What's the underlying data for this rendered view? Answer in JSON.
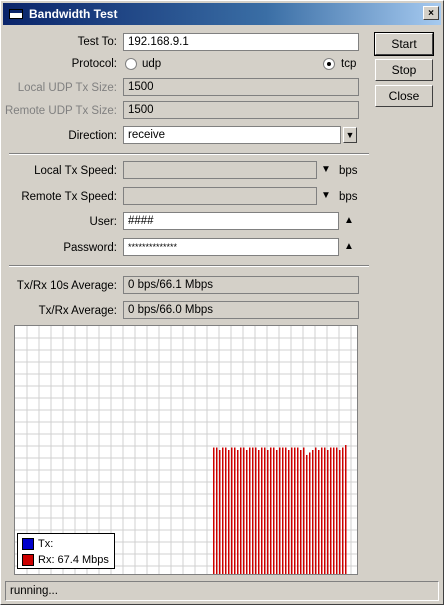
{
  "window": {
    "title": "Bandwidth Test",
    "close_glyph": "×"
  },
  "form": {
    "test_to": {
      "label": "Test To:",
      "value": "192.168.9.1"
    },
    "protocol": {
      "label": "Protocol:",
      "options": [
        "udp",
        "tcp"
      ],
      "selected": "tcp"
    },
    "local_udp_tx_size": {
      "label": "Local UDP Tx Size:",
      "value": "1500"
    },
    "remote_udp_tx_size": {
      "label": "Remote UDP Tx Size:",
      "value": "1500"
    },
    "direction": {
      "label": "Direction:",
      "value": "receive"
    },
    "local_tx_speed": {
      "label": "Local Tx Speed:",
      "value": "",
      "unit": "bps"
    },
    "remote_tx_speed": {
      "label": "Remote Tx Speed:",
      "value": "",
      "unit": "bps"
    },
    "user": {
      "label": "User:",
      "value": "####"
    },
    "password": {
      "label": "Password:",
      "value": "**************"
    },
    "avg_10s": {
      "label": "Tx/Rx 10s Average:",
      "value": "0 bps/66.1 Mbps"
    },
    "avg": {
      "label": "Tx/Rx Average:",
      "value": "0 bps/66.0 Mbps"
    }
  },
  "buttons": {
    "start": "Start",
    "stop": "Stop",
    "close": "Close"
  },
  "legend": {
    "tx": {
      "label": "Tx:",
      "color": "#0000cc"
    },
    "rx": {
      "label": "Rx:  67.4 Mbps",
      "color": "#cc0000"
    }
  },
  "status": "running...",
  "chart_data": {
    "type": "bar",
    "series": [
      {
        "name": "Rx",
        "color": "#cc0000",
        "active_from_fraction": 0.58,
        "level_fraction": [
          0.51,
          0.51,
          0.5,
          0.51,
          0.51,
          0.5,
          0.51,
          0.51,
          0.5,
          0.51,
          0.51,
          0.5,
          0.51,
          0.51,
          0.51,
          0.5,
          0.51,
          0.51,
          0.5,
          0.51,
          0.51,
          0.5,
          0.51,
          0.51,
          0.51,
          0.5,
          0.51,
          0.51,
          0.51,
          0.5,
          0.51,
          0.48,
          0.49,
          0.5,
          0.51,
          0.5,
          0.51,
          0.51,
          0.5,
          0.51,
          0.51,
          0.51,
          0.5,
          0.51,
          0.52
        ]
      },
      {
        "name": "Tx",
        "color": "#0000cc",
        "level_fraction": []
      }
    ],
    "grid": true
  }
}
